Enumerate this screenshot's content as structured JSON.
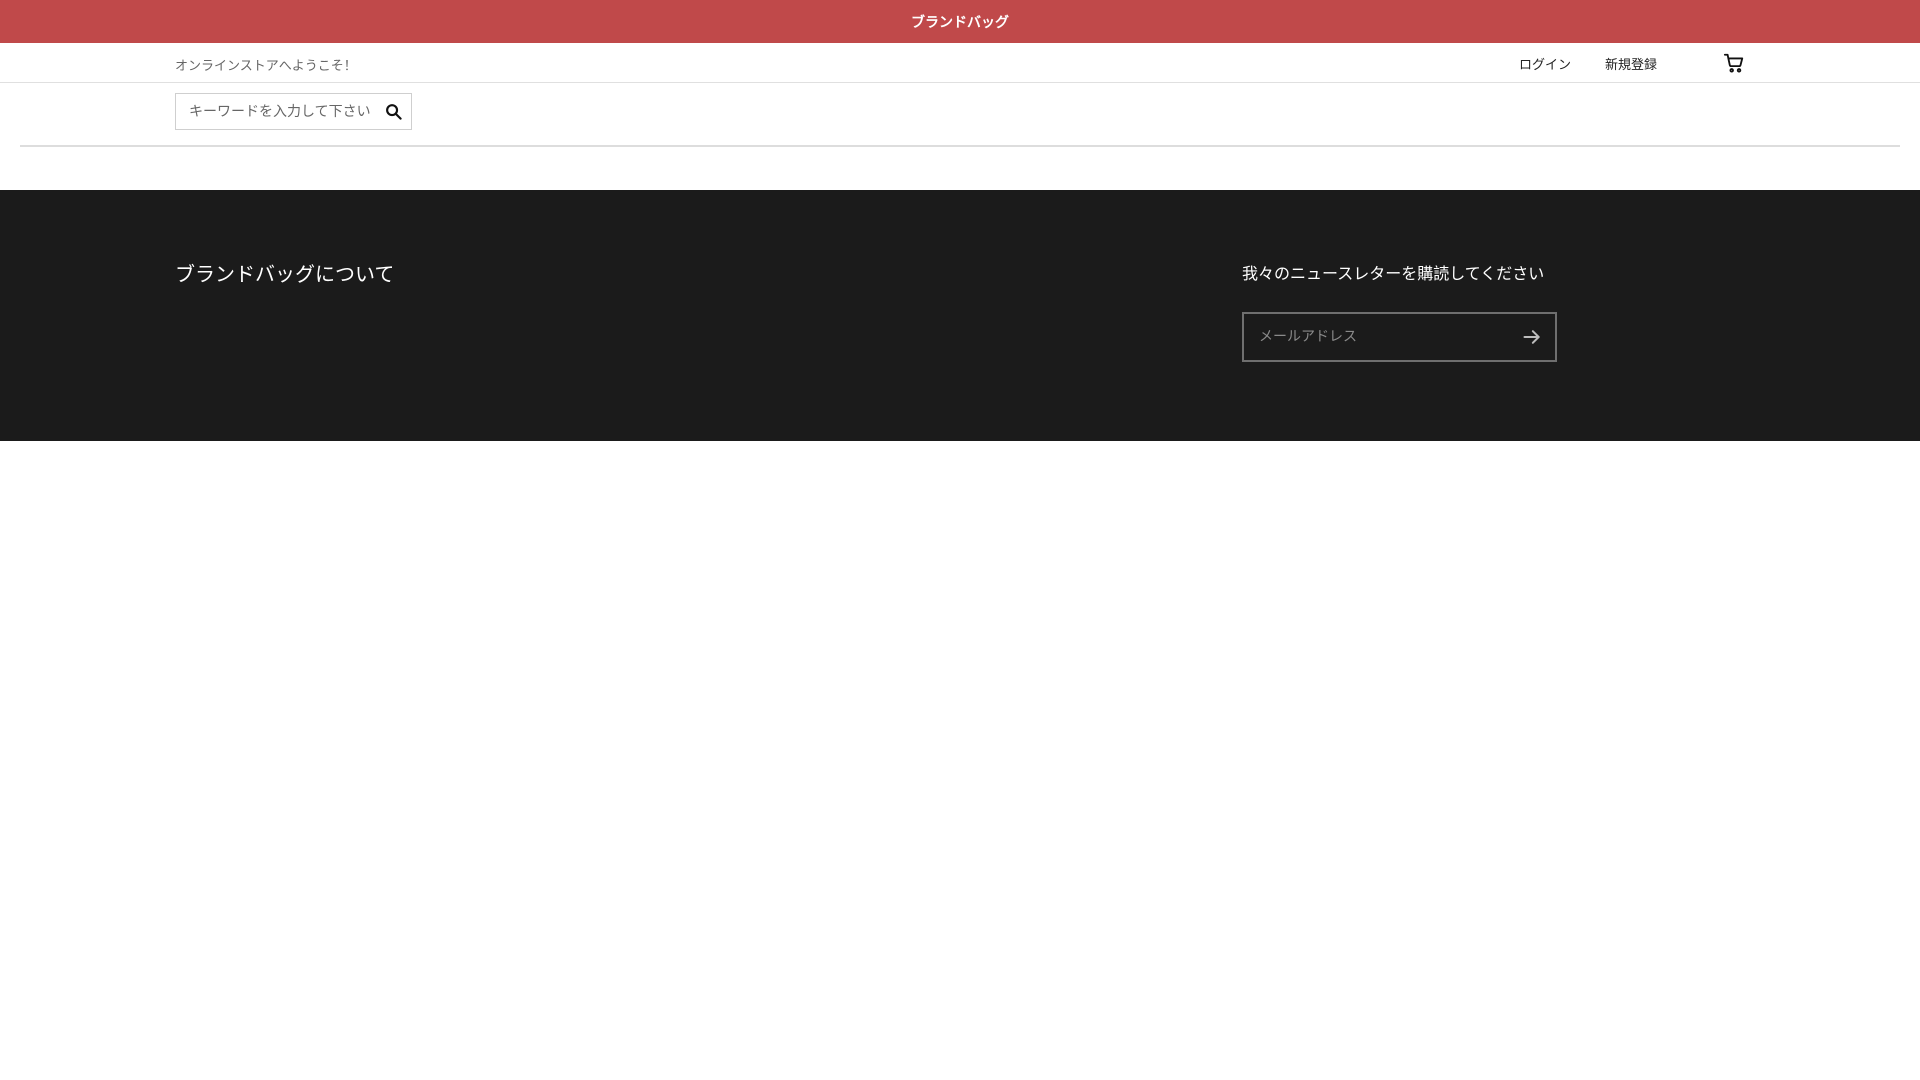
{
  "announcement": {
    "text": "ブランドバッグ",
    "background_color": "#c0494a"
  },
  "header": {
    "welcome_text": "オンラインストアへようこそ！",
    "login_label": "ログイン",
    "register_label": "新規登録",
    "cart_icon": "cart-icon"
  },
  "search": {
    "placeholder": "キーワードを入力して下さい",
    "icon": "search-icon"
  },
  "footer": {
    "background_color": "#1b1b1b",
    "about_title": "ブランドバッグについて",
    "newsletter": {
      "title": "我々のニュースレターを購読してください",
      "email_placeholder": "メールアドレス",
      "submit_icon": "arrow-right-icon"
    }
  }
}
